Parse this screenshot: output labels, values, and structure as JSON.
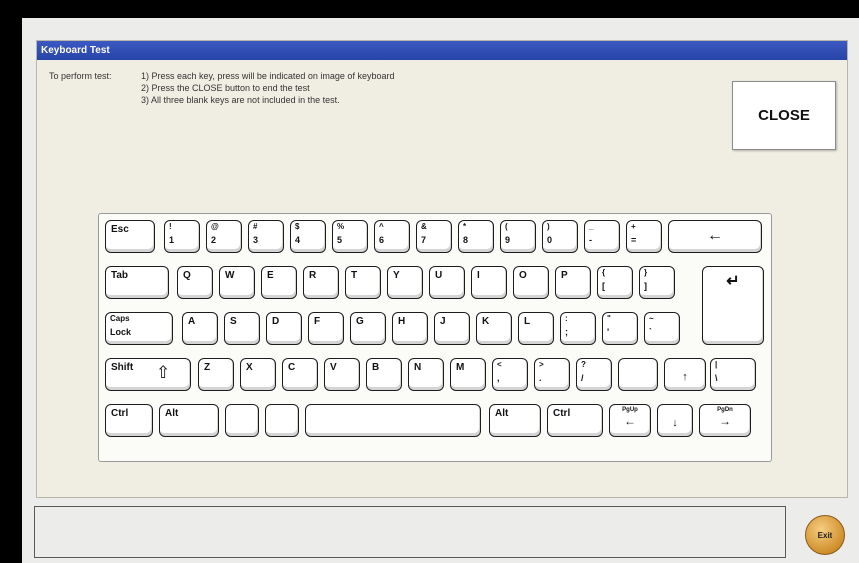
{
  "window": {
    "title": "Keyboard Test"
  },
  "instructions": {
    "label": "To perform test:",
    "lines": [
      "1) Press each key, press will be indicated on image of keyboard",
      "2) Press the CLOSE button to end the test",
      "3) All three blank keys are not included in the test."
    ]
  },
  "close_button": "CLOSE",
  "exit_button": "Exit",
  "status_text": "",
  "keyboard": {
    "row1": [
      {
        "label": "Esc"
      },
      {
        "top": "!",
        "bottom": "1"
      },
      {
        "top": "@",
        "bottom": "2"
      },
      {
        "top": "#",
        "bottom": "3"
      },
      {
        "top": "$",
        "bottom": "4"
      },
      {
        "top": "%",
        "bottom": "5"
      },
      {
        "top": "^",
        "bottom": "6"
      },
      {
        "top": "&",
        "bottom": "7"
      },
      {
        "top": "*",
        "bottom": "8"
      },
      {
        "top": "(",
        "bottom": "9"
      },
      {
        "top": ")",
        "bottom": "0"
      },
      {
        "top": "_",
        "bottom": "-"
      },
      {
        "top": "+",
        "bottom": "="
      },
      {
        "arrow": "←"
      }
    ],
    "row2": [
      {
        "label": "Tab"
      },
      {
        "label": "Q"
      },
      {
        "label": "W"
      },
      {
        "label": "E"
      },
      {
        "label": "R"
      },
      {
        "label": "T"
      },
      {
        "label": "Y"
      },
      {
        "label": "U"
      },
      {
        "label": "I"
      },
      {
        "label": "O"
      },
      {
        "label": "P"
      },
      {
        "top": "{",
        "bottom": "["
      },
      {
        "top": "}",
        "bottom": "]"
      }
    ],
    "enter": {
      "arrow": "↵"
    },
    "row3": [
      {
        "top": "Caps",
        "bottom": "Lock"
      },
      {
        "label": "A"
      },
      {
        "label": "S"
      },
      {
        "label": "D"
      },
      {
        "label": "F"
      },
      {
        "label": "G"
      },
      {
        "label": "H"
      },
      {
        "label": "J"
      },
      {
        "label": "K"
      },
      {
        "label": "L"
      },
      {
        "top": ":",
        "bottom": ";"
      },
      {
        "top": "\"",
        "bottom": "'"
      },
      {
        "top": "~",
        "bottom": "`"
      }
    ],
    "row4": [
      {
        "label": "Shift"
      },
      {
        "label": "Z"
      },
      {
        "label": "X"
      },
      {
        "label": "C"
      },
      {
        "label": "V"
      },
      {
        "label": "B"
      },
      {
        "label": "N"
      },
      {
        "label": "M"
      },
      {
        "top": "<",
        "bottom": ","
      },
      {
        "top": ">",
        "bottom": "."
      },
      {
        "top": "?",
        "bottom": "/"
      },
      {
        "label": ""
      },
      {
        "arrow": "↑"
      },
      {
        "top": "|",
        "bottom": "\\"
      }
    ],
    "row5": [
      {
        "label": "Ctrl"
      },
      {
        "label": "Alt"
      },
      {
        "label": ""
      },
      {
        "label": ""
      },
      {
        "label": ""
      },
      {
        "label": "Alt"
      },
      {
        "label": "Ctrl"
      },
      {
        "mini": "PgUp",
        "under": "←"
      },
      {
        "arrow": "↓"
      },
      {
        "mini": "PgDn",
        "under": "→"
      }
    ]
  }
}
